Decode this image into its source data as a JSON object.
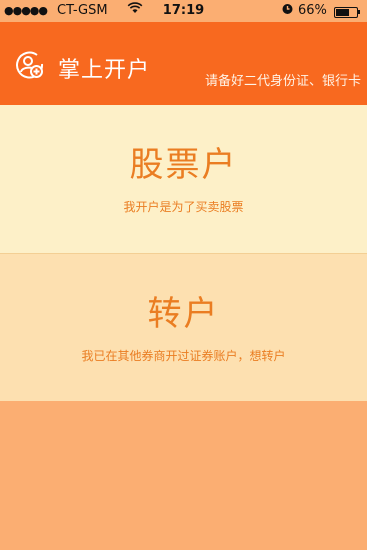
{
  "status_bar": {
    "signal": "●●●●●",
    "carrier": "CT-GSM",
    "time": "17:19",
    "battery": "66%",
    "battery_level": 0.66
  },
  "header": {
    "title": "掌上开户",
    "subtitle": "请备好二代身份证、银行卡"
  },
  "options": [
    {
      "title": "股票户",
      "desc": "我开户是为了买卖股票"
    },
    {
      "title": "转户",
      "desc": "我已在其他券商开过证券账户，想转户"
    }
  ],
  "colors": {
    "header_bg": "#f8691f",
    "card_stock_bg": "#fdf0c8",
    "card_transfer_bg": "#fde0b0",
    "accent_text": "#ea7d22",
    "bottom_bg": "#fbae72"
  },
  "icons": {
    "logo": "person-add-icon",
    "wifi": "wifi-icon",
    "alarm": "alarm-icon",
    "battery": "battery-icon"
  }
}
